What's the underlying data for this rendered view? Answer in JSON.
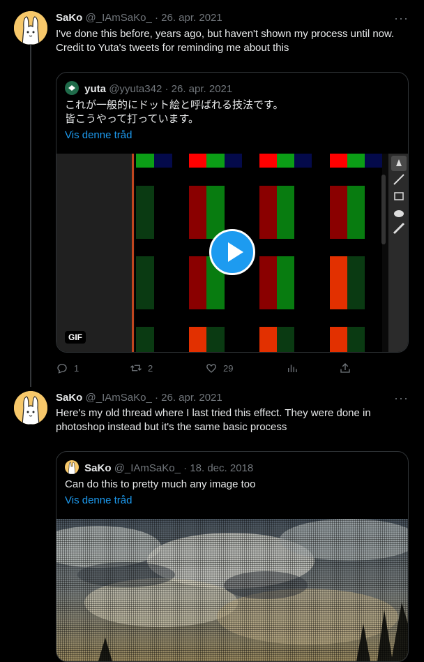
{
  "tweet1": {
    "name": "SaKo",
    "handle": "@_IAmSaKo_",
    "date": "26. apr. 2021",
    "text_line1": "I've done this before, years ago, but haven't shown my process until now.",
    "text_line2": "Credit to Yuta's tweets for reminding me about this",
    "quote": {
      "name": "yuta",
      "handle": "@yyuta342",
      "date": "26. apr. 2021",
      "text_line1": "これが一般的にドット絵と呼ばれる技法です。",
      "text_line2": "皆こうやって打っています。",
      "thread_link": "Vis denne tråd",
      "media_badge": "GIF"
    },
    "actions": {
      "replies": "1",
      "retweets": "2",
      "likes": "29",
      "views": "",
      "share": ""
    }
  },
  "tweet2": {
    "name": "SaKo",
    "handle": "@_IAmSaKo_",
    "date": "26. apr. 2021",
    "text_line1": "Here's my old thread where I last tried this effect. They were done in",
    "text_line2": "photoshop instead but it's the same basic process",
    "quote": {
      "name": "SaKo",
      "handle": "@_IAmSaKo_",
      "date": "18. dec. 2018",
      "text_line1": "Can do this to pretty much any image too",
      "thread_link": "Vis denne tråd"
    }
  },
  "colors": {
    "accent": "#1d9bf0",
    "text": "#e7e9ea",
    "muted": "#71767b",
    "border": "#2f3336"
  },
  "icons": [
    "more-icon",
    "reply-icon",
    "retweet-icon",
    "like-icon",
    "views-icon",
    "share-icon",
    "play-icon"
  ]
}
